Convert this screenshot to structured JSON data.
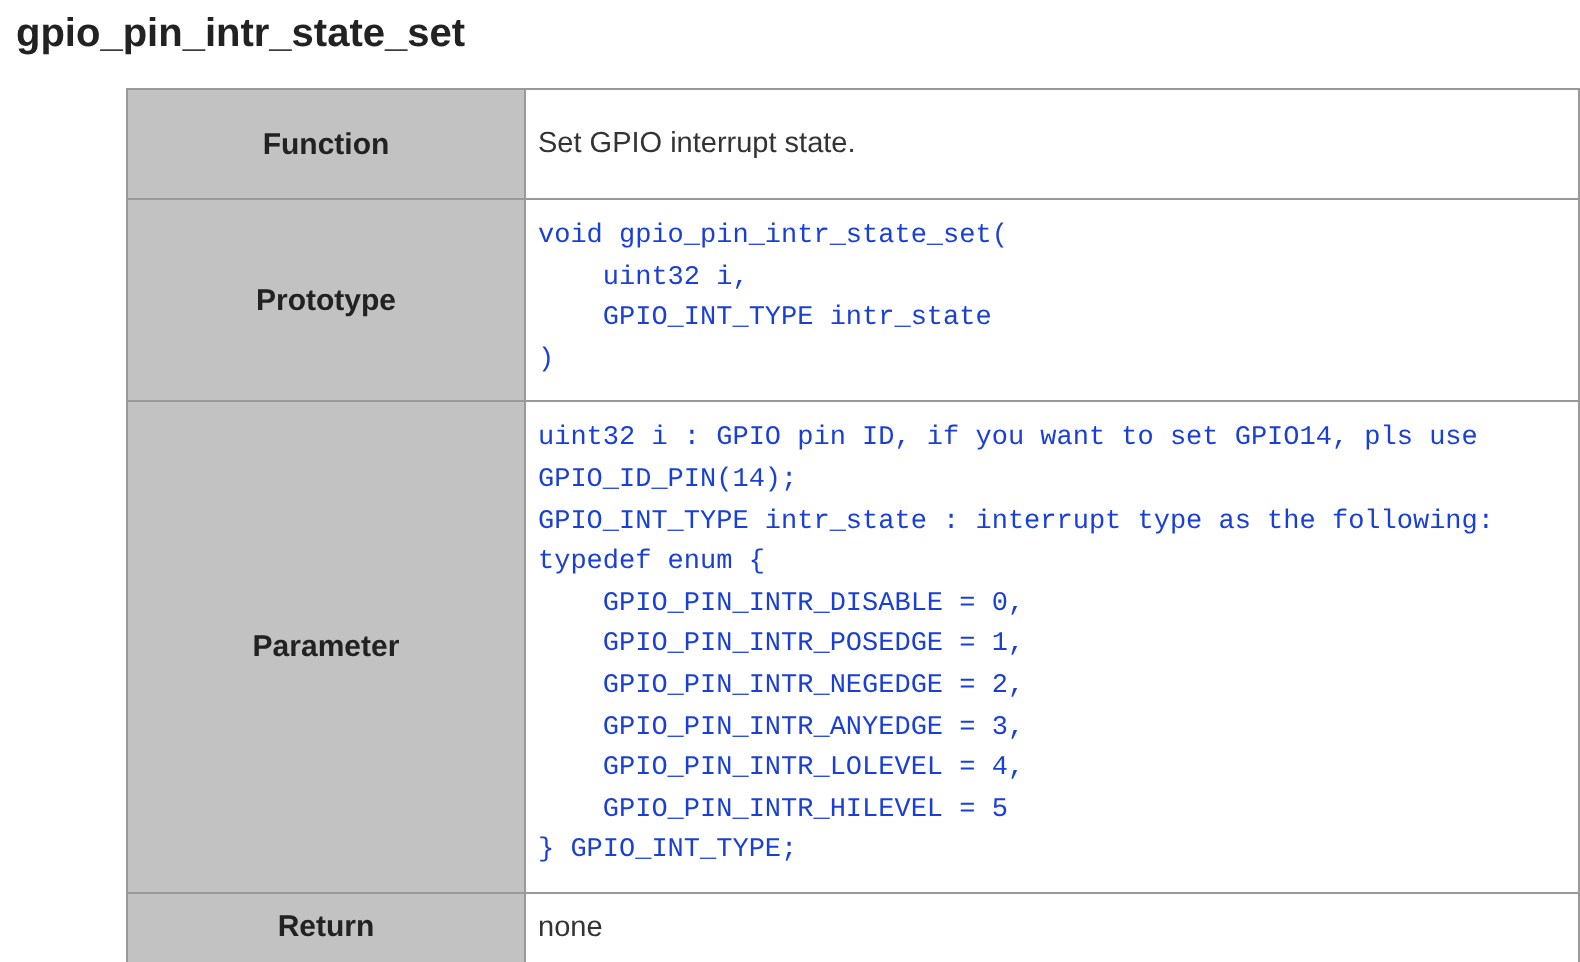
{
  "title": "gpio_pin_intr_state_set",
  "rows": [
    {
      "label": "Function",
      "kind": "text",
      "content": "Set GPIO interrupt state."
    },
    {
      "label": "Prototype",
      "kind": "code",
      "content": "void gpio_pin_intr_state_set(\n    uint32 i,\n    GPIO_INT_TYPE intr_state\n)"
    },
    {
      "label": "Parameter",
      "kind": "code",
      "content": "uint32 i : GPIO pin ID, if you want to set GPIO14, pls use\nGPIO_ID_PIN(14);\nGPIO_INT_TYPE intr_state : interrupt type as the following:\ntypedef enum {\n    GPIO_PIN_INTR_DISABLE = 0,\n    GPIO_PIN_INTR_POSEDGE = 1,\n    GPIO_PIN_INTR_NEGEDGE = 2,\n    GPIO_PIN_INTR_ANYEDGE = 3,\n    GPIO_PIN_INTR_LOLEVEL = 4,\n    GPIO_PIN_INTR_HILEVEL = 5\n} GPIO_INT_TYPE;"
    },
    {
      "label": "Return",
      "kind": "text",
      "content": "none"
    }
  ]
}
